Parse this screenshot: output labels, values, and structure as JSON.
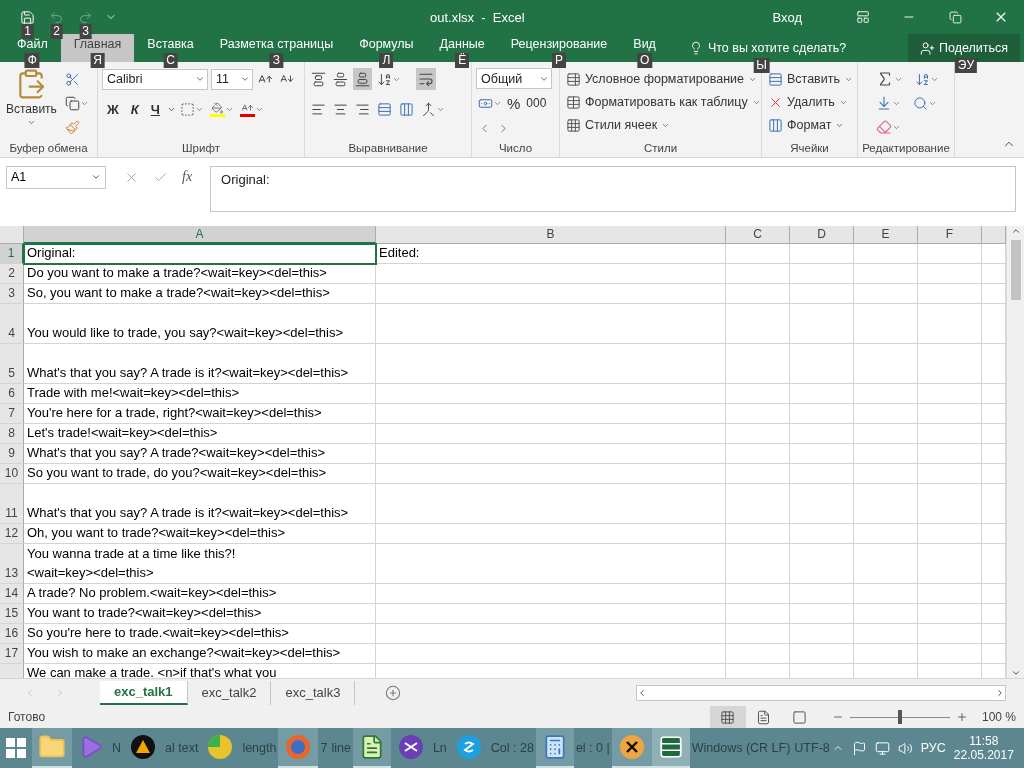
{
  "title_bar": {
    "title": "out.xlsx  -  Excel",
    "signin": "Вход",
    "quick_access": [
      {
        "kind": "save",
        "keytip": "1",
        "disabled": false
      },
      {
        "kind": "undo",
        "keytip": "2",
        "disabled": true
      },
      {
        "kind": "redo",
        "keytip": "3",
        "disabled": true
      }
    ]
  },
  "ribbon_tabs": [
    {
      "label": "Файл",
      "keytip": "Ф",
      "selected": false
    },
    {
      "label": "Главная",
      "keytip": "Я",
      "selected": true
    },
    {
      "label": "Вставка",
      "keytip": "С",
      "selected": false
    },
    {
      "label": "Разметка страницы",
      "keytip": "З",
      "selected": false
    },
    {
      "label": "Формулы",
      "keytip": "Л",
      "selected": false
    },
    {
      "label": "Данные",
      "keytip": "Ё",
      "selected": false
    },
    {
      "label": "Рецензирование",
      "keytip": "Р",
      "selected": false
    },
    {
      "label": "Вид",
      "keytip": "О",
      "selected": false
    }
  ],
  "tell_me": {
    "text": "Что вы хотите сделать?",
    "keytip": "Ы"
  },
  "share": {
    "label": "Поделиться",
    "keytip": "ЭУ"
  },
  "ribbon": {
    "clipboard": {
      "label": "Буфер обмена",
      "paste": "Вставить"
    },
    "font": {
      "label": "Шрифт",
      "name": "Calibri",
      "size": "11",
      "styles": [
        "Ж",
        "К",
        "Ч"
      ]
    },
    "alignment": {
      "label": "Выравнивание",
      "vertical": [
        {
          "selected": false
        },
        {
          "selected": false
        },
        {
          "selected": true
        }
      ],
      "wrap_text": {
        "selected": true
      }
    },
    "number": {
      "label": "Число",
      "format": "Общий",
      "percent": "%",
      "thousands": "000"
    },
    "styles": {
      "label": "Стили",
      "items": [
        "Условное форматирование",
        "Форматировать как таблицу",
        "Стили ячеек"
      ]
    },
    "cells": {
      "label": "Ячейки",
      "items": [
        "Вставить",
        "Удалить",
        "Формат"
      ]
    },
    "editing": {
      "label": "Редактирование"
    }
  },
  "formula_bar": {
    "name_box": "A1",
    "fx": "fx",
    "content": "Original:"
  },
  "sheet": {
    "columns": [
      {
        "label": "A",
        "selected": true
      },
      {
        "label": "B",
        "selected": false
      },
      {
        "label": "C",
        "selected": false
      },
      {
        "label": "D",
        "selected": false
      },
      {
        "label": "E",
        "selected": false
      },
      {
        "label": "F",
        "selected": false
      }
    ],
    "rows": [
      {
        "number": "1",
        "selected": true,
        "tall": false,
        "cells": [
          {
            "text": "Original:",
            "selected": true
          },
          {
            "text": "Edited:",
            "selected": false
          }
        ]
      },
      {
        "number": "2",
        "selected": false,
        "tall": false,
        "cells": [
          {
            "text": "Do you want to make a trade?<wait=key><del=this>",
            "selected": false
          }
        ]
      },
      {
        "number": "3",
        "selected": false,
        "tall": false,
        "cells": [
          {
            "text": "So, you want to make a trade?<wait=key><del=this>",
            "selected": false
          }
        ]
      },
      {
        "number": "4",
        "selected": false,
        "tall": true,
        "cells": [
          {
            "text": "You would like to trade, you say?<wait=key><del=this>",
            "selected": false
          }
        ]
      },
      {
        "number": "5",
        "selected": false,
        "tall": true,
        "cells": [
          {
            "text": "What's that you say? A trade is it?<wait=key><del=this>",
            "selected": false
          }
        ]
      },
      {
        "number": "6",
        "selected": false,
        "tall": false,
        "cells": [
          {
            "text": "Trade with me!<wait=key><del=this>",
            "selected": false
          }
        ]
      },
      {
        "number": "7",
        "selected": false,
        "tall": false,
        "cells": [
          {
            "text": "You're here for a trade, right?<wait=key><del=this>",
            "selected": false
          }
        ]
      },
      {
        "number": "8",
        "selected": false,
        "tall": false,
        "cells": [
          {
            "text": "Let's trade!<wait=key><del=this>",
            "selected": false
          }
        ]
      },
      {
        "number": "9",
        "selected": false,
        "tall": false,
        "cells": [
          {
            "text": "What's that you say? A trade?<wait=key><del=this>",
            "selected": false
          }
        ]
      },
      {
        "number": "10",
        "selected": false,
        "tall": false,
        "cells": [
          {
            "text": "So you want to trade, do you?<wait=key><del=this>",
            "selected": false
          }
        ]
      },
      {
        "number": "11",
        "selected": false,
        "tall": true,
        "cells": [
          {
            "text": "What's that you say? A trade is it?<wait=key><del=this>",
            "selected": false
          }
        ]
      },
      {
        "number": "12",
        "selected": false,
        "tall": false,
        "cells": [
          {
            "text": "Oh, you want to trade?<wait=key><del=this>",
            "selected": false
          }
        ]
      },
      {
        "number": "13",
        "selected": false,
        "tall": true,
        "cells": [
          {
            "text": "You wanna trade at a time like this?!<wait=key><del=this>",
            "selected": false,
            "wrapped": true
          }
        ]
      },
      {
        "number": "14",
        "selected": false,
        "tall": false,
        "cells": [
          {
            "text": "A trade? No problem.<wait=key><del=this>",
            "selected": false
          }
        ]
      },
      {
        "number": "15",
        "selected": false,
        "tall": false,
        "cells": [
          {
            "text": "You want to trade?<wait=key><del=this>",
            "selected": false
          }
        ]
      },
      {
        "number": "16",
        "selected": false,
        "tall": false,
        "cells": [
          {
            "text": "So you're here to trade.<wait=key><del=this>",
            "selected": false
          }
        ]
      },
      {
        "number": "17",
        "selected": false,
        "tall": false,
        "cells": [
          {
            "text": "You wish to make an exchange?<wait=key><del=this>",
            "selected": false
          }
        ]
      },
      {
        "selected": false,
        "tall": false,
        "cells": [
          {
            "text": "We can make a trade. <n>if that's what you",
            "selected": false
          }
        ]
      }
    ]
  },
  "sheet_tabs": [
    {
      "label": "exc_talk1",
      "selected": true
    },
    {
      "label": "exc_talk2",
      "selected": false
    },
    {
      "label": "exc_talk3",
      "selected": false
    }
  ],
  "status_bar": {
    "status": "Готово",
    "views": [
      {
        "selected": true
      },
      {
        "selected": false
      },
      {
        "selected": false
      }
    ],
    "zoom_slider": {
      "level": 0.5
    },
    "zoom": "100 %"
  },
  "taskbar": {
    "items": [
      {
        "kind": "start"
      },
      {
        "kind": "folder",
        "running": true,
        "selected": false
      },
      {
        "kind": "media",
        "running": false,
        "selected": false
      },
      {
        "kind": "text",
        "text": "N"
      },
      {
        "kind": "aimp",
        "running": false,
        "selected": false
      },
      {
        "kind": "text",
        "text": "al text"
      },
      {
        "kind": "ball",
        "running": false,
        "selected": false
      },
      {
        "kind": "text",
        "text": "length"
      },
      {
        "kind": "firefox",
        "running": true,
        "selected": false
      },
      {
        "kind": "text",
        "text": "7"
      },
      {
        "kind": "text",
        "text": "line"
      },
      {
        "kind": "notepad",
        "running": true,
        "selected": false
      },
      {
        "kind": "vs",
        "running": false,
        "selected": false
      },
      {
        "kind": "text",
        "text": "Ln"
      },
      {
        "kind": "skype",
        "running": false,
        "selected": false
      },
      {
        "kind": "text",
        "text": "Col : 28"
      },
      {
        "kind": "calculator",
        "running": true,
        "selected": false
      },
      {
        "kind": "text",
        "text": "el : 0 |"
      },
      {
        "kind": "hxd",
        "running": true,
        "selected": false
      },
      {
        "kind": "excel",
        "running": true,
        "selected": true
      },
      {
        "kind": "text",
        "text": "Windows (CR LF)"
      },
      {
        "kind": "text",
        "text": "UTF-8"
      }
    ],
    "tray": {
      "language": "РУС",
      "time": "11:58",
      "date": "22.05.2017"
    }
  }
}
